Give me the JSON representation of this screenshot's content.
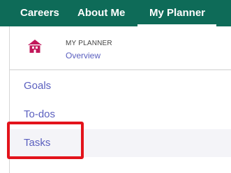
{
  "topnav": {
    "items": [
      {
        "label": "Careers"
      },
      {
        "label": "About Me"
      },
      {
        "label": "My Planner",
        "active": true
      }
    ],
    "background_color": "#0e6b58"
  },
  "dropdown": {
    "header": {
      "title": "MY PLANNER",
      "overview_link": "Overview",
      "icon": "house-icon",
      "icon_color": "#c2185b"
    },
    "items": [
      {
        "label": "Goals"
      },
      {
        "label": "To-dos"
      },
      {
        "label": "Tasks",
        "highlighted": true
      }
    ],
    "link_color": "#5a5fbf"
  },
  "annotation": {
    "highlight_color": "#e3131b",
    "target": "Tasks"
  }
}
